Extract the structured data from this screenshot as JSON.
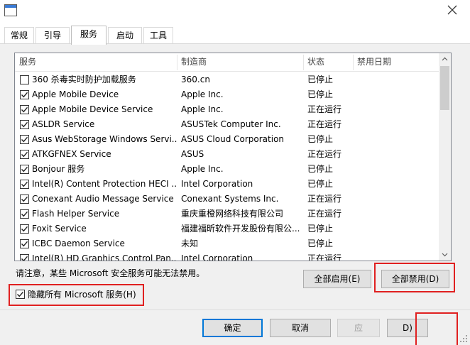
{
  "tabs": [
    "常规",
    "引导",
    "服务",
    "启动",
    "工具"
  ],
  "active_tab": "服务",
  "columns": [
    "服务",
    "制造商",
    "状态",
    "禁用日期"
  ],
  "rows": [
    {
      "checked": false,
      "name": "360 杀毒实时防护加载服务",
      "maker": "360.cn",
      "status": "已停止"
    },
    {
      "checked": true,
      "name": "Apple Mobile Device",
      "maker": "Apple Inc.",
      "status": "已停止"
    },
    {
      "checked": true,
      "name": "Apple Mobile Device Service",
      "maker": "Apple Inc.",
      "status": "正在运行"
    },
    {
      "checked": true,
      "name": "ASLDR Service",
      "maker": "ASUSTek Computer Inc.",
      "status": "正在运行"
    },
    {
      "checked": true,
      "name": "Asus WebStorage Windows Servi...",
      "maker": "ASUS Cloud Corporation",
      "status": "已停止"
    },
    {
      "checked": true,
      "name": "ATKGFNEX Service",
      "maker": "ASUS",
      "status": "正在运行"
    },
    {
      "checked": true,
      "name": "Bonjour 服务",
      "maker": "Apple Inc.",
      "status": "已停止"
    },
    {
      "checked": true,
      "name": "Intel(R) Content Protection HECI ...",
      "maker": "Intel Corporation",
      "status": "已停止"
    },
    {
      "checked": true,
      "name": "Conexant Audio Message Service",
      "maker": "Conexant Systems Inc.",
      "status": "正在运行"
    },
    {
      "checked": true,
      "name": "Flash Helper Service",
      "maker": "重庆重橙网络科技有限公司",
      "status": "正在运行"
    },
    {
      "checked": true,
      "name": "Foxit Service",
      "maker": "福建福昕软件开发股份有限公...",
      "status": "已停止"
    },
    {
      "checked": true,
      "name": "ICBC Daemon Service",
      "maker": "未知",
      "status": "已停止"
    },
    {
      "checked": true,
      "name": "Intel(R) HD Graphics Control Pan...",
      "maker": "Intel Corporation",
      "status": "正在运行"
    }
  ],
  "note": "请注意，某些 Microsoft 安全服务可能无法禁用。",
  "enable_all": "全部启用(E)",
  "disable_all": "全部禁用(D)",
  "hide_ms_label": "隐藏所有 Microsoft 服务(H)",
  "hide_ms_checked": true,
  "ok": "确定",
  "cancel": "取消",
  "apply": "应",
  "help_partial": "D)",
  "colors": {
    "accent": "#0078d7",
    "highlight": "#e02020",
    "panel": "#f0f0f0"
  }
}
